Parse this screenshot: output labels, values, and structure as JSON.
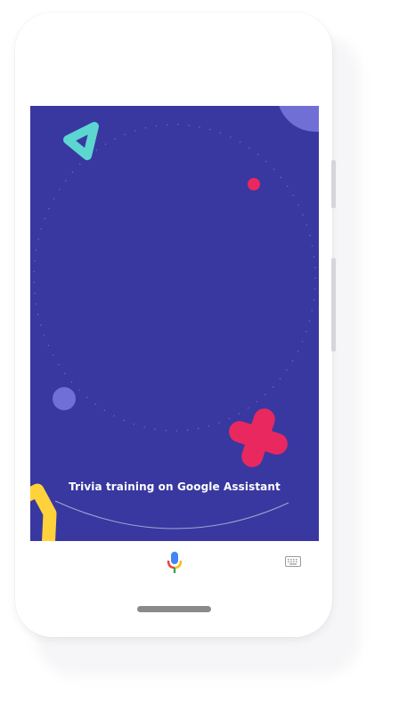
{
  "screen": {
    "title": "Trivia training on Google Assistant",
    "background_color": "#3838a0"
  },
  "decorations": [
    {
      "shape": "triangle",
      "color": "#5dd6d2"
    },
    {
      "shape": "dot",
      "color": "#e8285f"
    },
    {
      "shape": "circle",
      "color": "#6f6fd6"
    },
    {
      "shape": "cross",
      "color": "#e8285f"
    },
    {
      "shape": "rounded-hexagon",
      "color": "#ffd23c"
    },
    {
      "shape": "corner-circle",
      "color": "#6f6fd6"
    }
  ],
  "assistant_bar": {
    "mic_icon": "microphone-icon",
    "keyboard_icon": "keyboard-icon",
    "mic_colors": [
      "#4285f4",
      "#ea4335",
      "#fbbc05",
      "#34a853"
    ]
  },
  "navigation": {
    "home_indicator": "home-pill"
  }
}
